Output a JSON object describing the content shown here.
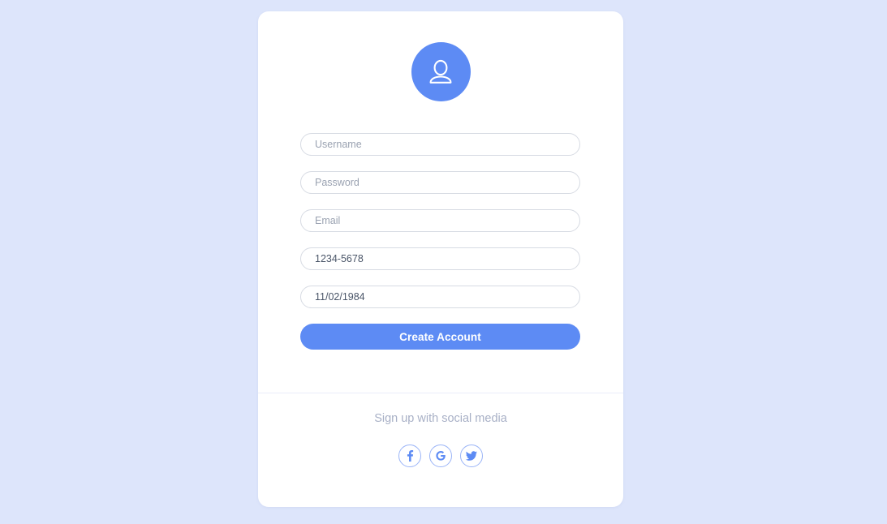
{
  "theme": {
    "page_background": "#dde5fb",
    "card_background": "#ffffff",
    "accent_blue": "#5d8bf4",
    "input_border": "#d7dbe3",
    "placeholder_color": "#9aa2b1",
    "value_color": "#4a5568",
    "muted_text": "#a8b0c6",
    "divider_color": "#e9eef9",
    "social_border": "#9ab4f7"
  },
  "card": {
    "avatar": {
      "icon": "user-avatar-icon",
      "background": "#5d8bf4",
      "glyph_color": "#ffffff"
    },
    "form": {
      "fields": [
        {
          "name": "username",
          "placeholder": "Username",
          "value": "",
          "type": "text",
          "state": "empty"
        },
        {
          "name": "password",
          "placeholder": "Password",
          "value": "",
          "type": "text",
          "state": "empty"
        },
        {
          "name": "email",
          "placeholder": "Email",
          "value": "",
          "type": "text",
          "state": "empty"
        },
        {
          "name": "phone",
          "placeholder": "",
          "value": "1234-5678",
          "type": "text",
          "state": "filled"
        },
        {
          "name": "birthdate",
          "placeholder": "",
          "value": "11/02/1984",
          "type": "text",
          "state": "filled"
        }
      ],
      "submit_label": "Create Account"
    },
    "social": {
      "label": "Sign up with social media",
      "buttons": [
        {
          "name": "facebook",
          "icon": "facebook-icon",
          "glyph": "f"
        },
        {
          "name": "google",
          "icon": "google-icon",
          "glyph": "G"
        },
        {
          "name": "twitter",
          "icon": "twitter-icon",
          "glyph": "bird"
        }
      ]
    }
  }
}
